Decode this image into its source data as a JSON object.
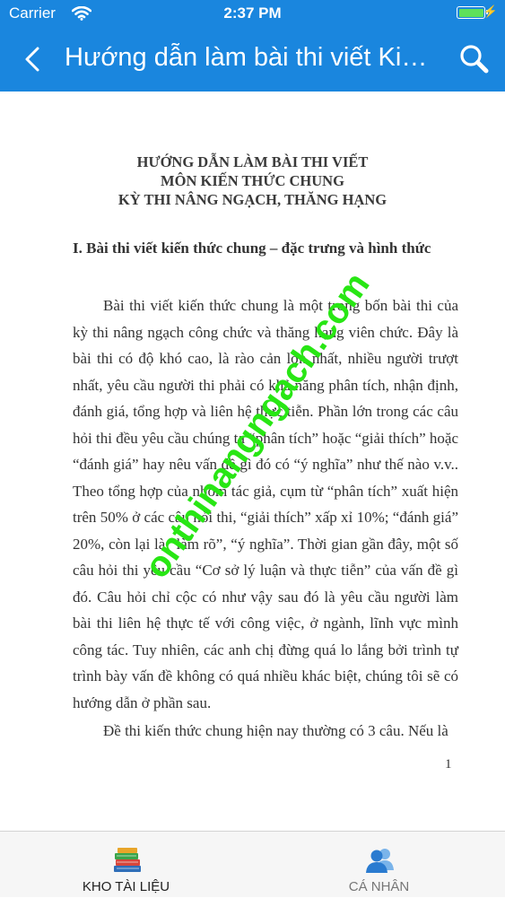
{
  "status_bar": {
    "carrier": "Carrier",
    "time": "2:37 PM",
    "battery_percent": 100,
    "battery_color": "#5ee05a"
  },
  "nav": {
    "title": "Hướng dẫn làm bài thi viết Kiến thức chung",
    "bar_color": "#1a86de"
  },
  "document": {
    "heading": [
      "HƯỚNG DẪN LÀM BÀI THI VIẾT",
      "MÔN KIẾN THỨC CHUNG",
      "KỲ THI NÂNG NGẠCH, THĂNG HẠNG"
    ],
    "section_title": "I. Bài thi viết kiến thức chung – đặc trưng và hình thức",
    "paragraphs": [
      "Bài thi viết kiến thức chung là một trong bốn bài thi của kỳ thi nâng ngạch công chức và thăng hạng viên chức. Đây là bài thi có độ khó cao, là rào cản lớn nhất, nhiều người trượt nhất, yêu cầu người thi phải có khả năng phân tích, nhận định, đánh giá, tổng hợp và liên hệ thực tiễn. Phần lớn trong các câu hỏi thi đều yêu cầu chúng ta “phân tích” hoặc “giải thích” hoặc “đánh giá” hay nêu vấn đề gì đó có “ý nghĩa” như thế nào v.v.. Theo tổng hợp của nhóm tác giả, cụm từ “phân tích” xuất hiện trên 50% ở các câu hỏi thi, “giải thích” xấp xỉ 10%; “đánh giá” 20%, còn lại là “làm rõ”, “ý nghĩa”. Thời gian gần đây, một số câu hỏi thi yêu cầu “Cơ sở lý luận và thực tiễn” của vấn đề gì đó. Câu hỏi chỉ cộc có như vậy sau đó là yêu cầu người làm bài thi liên hệ thực tế với công việc, ở ngành, lĩnh vực mình công tác. Tuy nhiên, các anh chị đừng quá lo lắng bởi trình tự trình bày vấn đề không có quá nhiều khác biệt, chúng tôi sẽ có hướng dẫn ở phần sau.",
      "Đề thi kiến thức chung hiện nay thường có 3 câu. Nếu là"
    ],
    "page_number": "1",
    "watermark": "onthinangngach.com",
    "watermark_color": "#28e614"
  },
  "tabbar": {
    "tabs": [
      {
        "label": "KHO TÀI LIỆU",
        "icon": "books-icon",
        "active": true
      },
      {
        "label": "CÁ NHÂN",
        "icon": "users-icon",
        "active": false
      }
    ]
  }
}
